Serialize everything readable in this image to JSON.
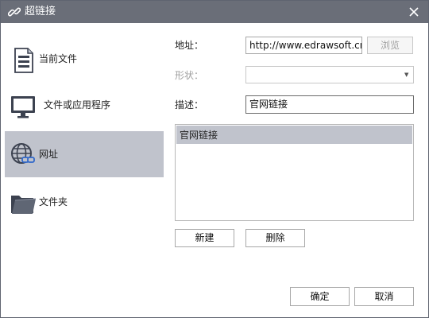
{
  "window": {
    "title": "超链接",
    "close_icon": "close-icon",
    "title_icon": "link-icon",
    "titlebar_color": "#6a6e78",
    "selected_color": "#c0c3cc"
  },
  "sidebar": {
    "items": [
      {
        "label": "当前文件",
        "icon": "document-icon",
        "selected": false
      },
      {
        "label": "文件或应用程序",
        "icon": "monitor-icon",
        "selected": false
      },
      {
        "label": "网址",
        "icon": "globe-link-icon",
        "selected": true
      },
      {
        "label": "文件夹",
        "icon": "folder-icon",
        "selected": false
      }
    ]
  },
  "form": {
    "address_label": "地址：",
    "address_value": "http://www.edrawsoft.cn",
    "browse_label": "浏览",
    "shape_label": "形状：",
    "shape_value": "",
    "description_label": "描述：",
    "description_value": "官网链接"
  },
  "links_list": {
    "items": [
      "官网链接"
    ],
    "selected_index": 0
  },
  "actions": {
    "new_label": "新建",
    "delete_label": "删除",
    "ok_label": "确定",
    "cancel_label": "取消"
  }
}
